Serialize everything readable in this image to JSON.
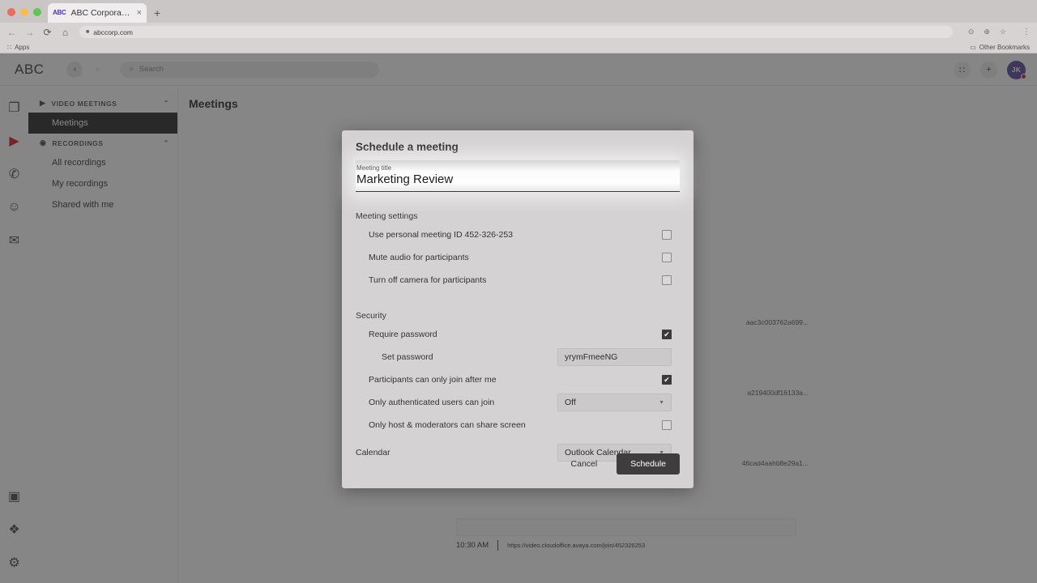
{
  "browser": {
    "tab": {
      "favicon_text": "ABC",
      "title": "ABC Corporation",
      "close_glyph": "×"
    },
    "new_tab_glyph": "+",
    "nav": {
      "back": "←",
      "forward": "→",
      "reload": "⟳",
      "home": "⌂"
    },
    "omnibox": {
      "lock_glyph": "■",
      "url": "abccorp.com"
    },
    "omni_actions": {
      "share": "⊙",
      "zoom": "⊕",
      "bookmark": "☆",
      "menu": "⋮"
    },
    "bookmarks": {
      "apps_label": "Apps",
      "apps_glyph": "∷",
      "other_label": "Other Bookmarks",
      "folder_glyph": "▭"
    }
  },
  "app_header": {
    "brand": "ABC",
    "back_glyph": "‹",
    "forward_glyph": "›",
    "search_placeholder": "Search",
    "search_glyph": "⌕",
    "dialpad_glyph": "∷",
    "plus_glyph": "+",
    "avatar_initials": "JK"
  },
  "rail": {
    "items": [
      {
        "name": "messages",
        "glyph": "❐"
      },
      {
        "name": "video",
        "glyph": "▶"
      },
      {
        "name": "phone",
        "glyph": "✆"
      },
      {
        "name": "contacts",
        "glyph": "☺"
      },
      {
        "name": "fax",
        "glyph": "✉"
      }
    ],
    "bottom_items": [
      {
        "name": "whiteboard",
        "glyph": "▣"
      },
      {
        "name": "apps",
        "glyph": "❖"
      },
      {
        "name": "settings",
        "glyph": "⚙"
      }
    ]
  },
  "sidebar": {
    "groups": [
      {
        "label": "VIDEO MEETINGS",
        "icon_glyph": "▶",
        "chevron": "⌃",
        "items": [
          {
            "label": "Meetings",
            "selected": true
          }
        ]
      },
      {
        "label": "RECORDINGS",
        "icon_glyph": "◉",
        "chevron": "⌃",
        "items": [
          {
            "label": "All recordings",
            "selected": false
          },
          {
            "label": "My recordings",
            "selected": false
          },
          {
            "label": "Shared with me",
            "selected": false
          }
        ]
      }
    ]
  },
  "main": {
    "page_title": "Meetings",
    "background_hashes": [
      "aac3c003762a699...",
      "a219400df16133a...",
      "46cad4aahb8e29a1..."
    ],
    "background_meeting": {
      "time": "10:30 AM",
      "url": "https://video.cloudoffice.avaya.com/join/452326253"
    }
  },
  "modal": {
    "title": "Schedule a meeting",
    "meeting_title": {
      "label": "Meeting title",
      "value": "Marketing Review"
    },
    "sections": [
      {
        "label": "Meeting settings"
      },
      {
        "label": "Security"
      }
    ],
    "meeting_settings": [
      {
        "label": "Use personal meeting ID 452-326-253",
        "checked": false
      },
      {
        "label": "Mute audio for participants",
        "checked": false
      },
      {
        "label": "Turn off camera for participants",
        "checked": false
      }
    ],
    "security": {
      "require_password": {
        "label": "Require password",
        "checked": true
      },
      "set_password": {
        "label": "Set password",
        "value": "yrymFmeeNG"
      },
      "join_after_me": {
        "label": "Participants can only join after me",
        "checked": true
      },
      "authenticated": {
        "label": "Only authenticated users can join",
        "value": "Off"
      },
      "share_screen": {
        "label": "Only host & moderators can share screen",
        "checked": false
      }
    },
    "calendar": {
      "label": "Calendar",
      "value": "Outlook Calendar"
    },
    "actions": {
      "cancel": "Cancel",
      "schedule": "Schedule"
    },
    "checkmark_glyph": "✔",
    "caret_glyph": "▼"
  },
  "colors": {
    "accent_red": "#d8232a",
    "avatar_purple": "#5b4b9e",
    "favicon_blue": "#4b32c3",
    "selected_nav": "#2f2d2e",
    "primary_button": "#3f3d3e"
  }
}
